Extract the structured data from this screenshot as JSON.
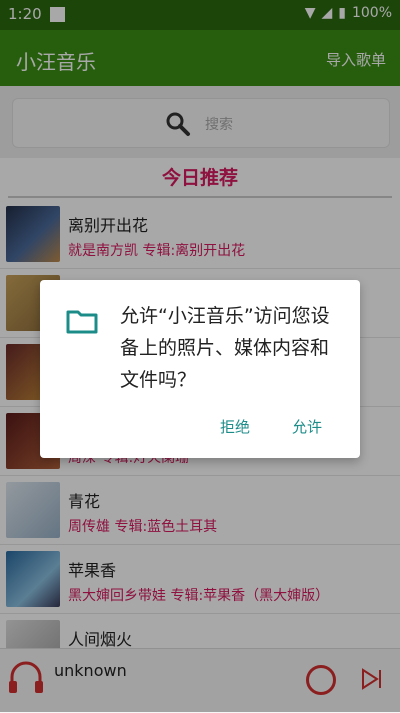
{
  "status_bar": {
    "time": "1:20",
    "battery": "100%"
  },
  "app_bar": {
    "title": "小汪音乐",
    "import_label": "导入歌单"
  },
  "search": {
    "placeholder": "搜索"
  },
  "section": {
    "title": "今日推荐"
  },
  "songs": [
    {
      "name": "离别开出花",
      "meta": "就是南方凯   专辑:离别开出花"
    },
    {
      "name": "",
      "meta": ""
    },
    {
      "name": "",
      "meta": ""
    },
    {
      "name": "",
      "meta": "周深   专辑:灯火阑珊"
    },
    {
      "name": "青花",
      "meta": "周传雄   专辑:蓝色土耳其"
    },
    {
      "name": "苹果香",
      "meta": "黑大婶回乡带娃   专辑:苹果香（黑大婶版）"
    },
    {
      "name": "人间烟火",
      "meta": ""
    }
  ],
  "player": {
    "track": "unknown"
  },
  "dialog": {
    "message": "允许“小汪音乐”访问您设备上的照片、媒体内容和文件吗？",
    "deny_label": "拒绝",
    "allow_label": "允许"
  },
  "colors": {
    "status_bar": "#2b6a0f",
    "app_bar": "#3b8f16",
    "accent_pink": "#d81b60",
    "dialog_button": "#1b8c88"
  }
}
